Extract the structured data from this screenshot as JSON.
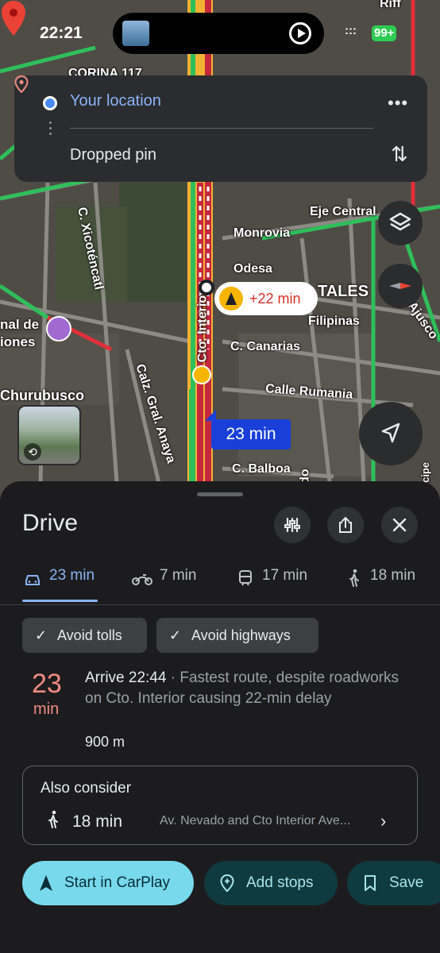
{
  "status_bar": {
    "time": "22:21",
    "signal": ":::",
    "battery": "99+"
  },
  "route_card": {
    "from": "Your location",
    "to": "Dropped pin",
    "more_icon": "more-horizontal-icon",
    "swap_icon": "swap-vertical-icon"
  },
  "map": {
    "labels": {
      "corina": "CORINA 117",
      "riff": "Riff",
      "eje_central": "Eje Central",
      "monrovia": "Monrovia",
      "odesa": "Odesa",
      "tales": "TALES",
      "filipinas": "Filipinas",
      "ajusco": "Ajusco",
      "canarias": "C. Canarias",
      "rumania": "Calle Rumania",
      "balboa": "C. Balboa",
      "xicotencatl": "C. Xicoténcatl",
      "anaya": "Calz. Gral. Anaya",
      "cto_interior": "Cto. Interior",
      "churubusco": "Churubusco",
      "museo": "nal de iones",
      "nevado": "vado",
      "principe": "Príncipe"
    },
    "traffic_delay": "+22 min",
    "route_eta": "23 min",
    "colors": {
      "route": "#c5283d",
      "traffic_red": "#e0303a",
      "traffic_yellow": "#f2b233",
      "traffic_green": "#2fbf5a",
      "route_blue": "#1a3fd9"
    }
  },
  "sheet": {
    "title": "Drive",
    "tabs": [
      {
        "icon": "car-icon",
        "label": "23 min",
        "active": true
      },
      {
        "icon": "motorcycle-icon",
        "label": "7 min",
        "active": false
      },
      {
        "icon": "transit-icon",
        "label": "17 min",
        "active": false
      },
      {
        "icon": "walk-icon",
        "label": "18 min",
        "active": false
      }
    ],
    "chips": [
      {
        "label": "Avoid tolls"
      },
      {
        "label": "Avoid highways"
      }
    ],
    "route": {
      "duration": "23",
      "duration_unit": "min",
      "arrive": "Arrive 22:44",
      "description": " · Fastest route, despite roadworks on Cto. Interior causing 22-min delay",
      "distance": "900 m"
    },
    "also_consider": {
      "title": "Also consider",
      "time": "18 min",
      "route": "Av. Nevado and Cto Interior Ave..."
    },
    "buttons": {
      "start": "Start in CarPlay",
      "add_stops": "Add stops",
      "save": "Save"
    }
  }
}
